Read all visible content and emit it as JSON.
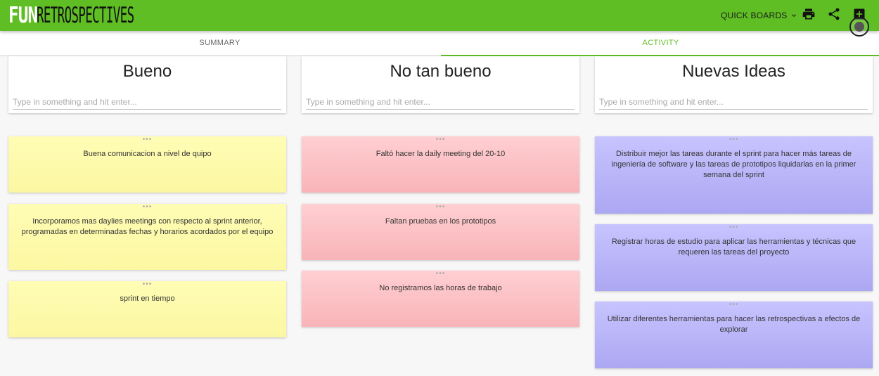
{
  "app": {
    "logo_fun": "FUN",
    "logo_retro": "RETROSPECTIVES"
  },
  "toolbar": {
    "quick_boards_label": "QUICK BOARDS"
  },
  "tabs": [
    {
      "label": "SUMMARY"
    },
    {
      "label": "ACTIVITY",
      "active": true
    }
  ],
  "columns": [
    {
      "title": "Bueno",
      "placeholder": "Type in something and hit enter...",
      "color": "#fbf7a2",
      "notes": [
        {
          "handle": "•••",
          "text": "Buena comunicacion a nivel de quipo"
        },
        {
          "handle": "•••",
          "text": "Incorporamos mas daylies meetings con respecto al sprint anterior, programadas en determinadas fechas y horarios acordados por el equipo"
        },
        {
          "handle": "•••",
          "text": "sprint en tiempo"
        }
      ]
    },
    {
      "title": "No tan bueno",
      "placeholder": "Type in something and hit enter...",
      "color": "#f8b4b8",
      "notes": [
        {
          "handle": "•••",
          "text": "Faltó hacer la daily meeting del 20-10"
        },
        {
          "handle": "•••",
          "text": "Faltan pruebas en los prototipos"
        },
        {
          "handle": "•••",
          "text": "No registramos las horas de trabajo"
        }
      ]
    },
    {
      "title": "Nuevas Ideas",
      "placeholder": "Type in something and hit enter...",
      "color": "#aca7f2",
      "notes": [
        {
          "handle": "•••",
          "text": "Distribuir mejor las tareas durante el sprint para hacer más tareas de ingeniería de software y las tareas de prototipos liquidarlas en la primer semana del sprint"
        },
        {
          "handle": "•••",
          "text": "Registrar horas de estudio para aplicar las herramientas y técnicas que requeren las tareas del proyecto"
        },
        {
          "handle": "•••",
          "text": "Utilizar diferentes herramientas para hacer las retrospectivas a efectos de explorar"
        }
      ]
    }
  ],
  "icons": [
    "chevron-down-icon",
    "print-icon",
    "share-icon",
    "add-box-icon",
    "record-icon"
  ],
  "colors": {
    "header": "#5fbe24",
    "accent": "#5fbe24"
  }
}
